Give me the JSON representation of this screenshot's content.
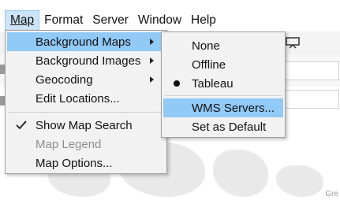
{
  "menubar": {
    "items": [
      {
        "label": "Map",
        "active": true
      },
      {
        "label": "Format"
      },
      {
        "label": "Server"
      },
      {
        "label": "Window"
      },
      {
        "label": "Help"
      }
    ]
  },
  "map_menu": {
    "items": [
      {
        "label": "Background Maps",
        "submenu": true,
        "highlighted": true
      },
      {
        "label": "Background Images",
        "submenu": true
      },
      {
        "label": "Geocoding",
        "submenu": true
      },
      {
        "label": "Edit Locations..."
      },
      {
        "label": "Show Map Search",
        "checked": true
      },
      {
        "label": "Map Legend",
        "disabled": true
      },
      {
        "label": "Map Options..."
      }
    ]
  },
  "background_maps_menu": {
    "items": [
      {
        "label": "None"
      },
      {
        "label": "Offline"
      },
      {
        "label": "Tableau",
        "selected": true
      },
      {
        "label": "WMS Servers...",
        "highlighted": true
      },
      {
        "label": "Set as Default"
      }
    ]
  },
  "map_attribution": "Gre",
  "colors": {
    "highlight": "#91c9f7",
    "menu_bg": "#f2f2f2",
    "menubar_active": "#cce4f7"
  }
}
